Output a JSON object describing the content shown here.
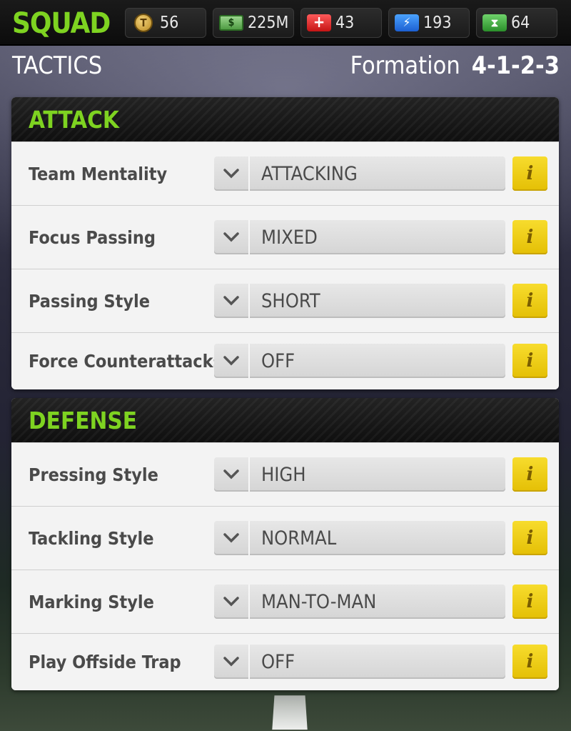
{
  "header": {
    "title": "SQUAD",
    "resources": [
      {
        "icon": "token-coin-icon",
        "glyph": "T",
        "value": "56"
      },
      {
        "icon": "cash-icon",
        "glyph": "$",
        "value": "225M"
      },
      {
        "icon": "medical-icon",
        "glyph": "+",
        "value": "43"
      },
      {
        "icon": "energy-icon",
        "glyph": "⚡",
        "value": "193"
      },
      {
        "icon": "hourglass-icon",
        "glyph": "⧗",
        "value": "64"
      }
    ]
  },
  "subheader": {
    "title": "TACTICS",
    "formation_label": "Formation",
    "formation_value": "4-1-2-3"
  },
  "attack": {
    "title": "ATTACK",
    "rows": [
      {
        "label": "Team Mentality",
        "value": "ATTACKING",
        "info": "i"
      },
      {
        "label": "Focus Passing",
        "value": "MIXED",
        "info": "i"
      },
      {
        "label": "Passing Style",
        "value": "SHORT",
        "info": "i"
      },
      {
        "label": "Force Counterattacks",
        "value": "OFF",
        "info": "i"
      }
    ]
  },
  "defense": {
    "title": "DEFENSE",
    "rows": [
      {
        "label": "Pressing Style",
        "value": "HIGH",
        "info": "i"
      },
      {
        "label": "Tackling Style",
        "value": "NORMAL",
        "info": "i"
      },
      {
        "label": "Marking Style",
        "value": "MAN-TO-MAN",
        "info": "i"
      },
      {
        "label": "Play Offside Trap",
        "value": "OFF",
        "info": "i"
      }
    ]
  },
  "colors": {
    "accent_green": "#7ed321",
    "info_yellow": "#f0cf17",
    "panel_bg": "#f1f1f1"
  }
}
